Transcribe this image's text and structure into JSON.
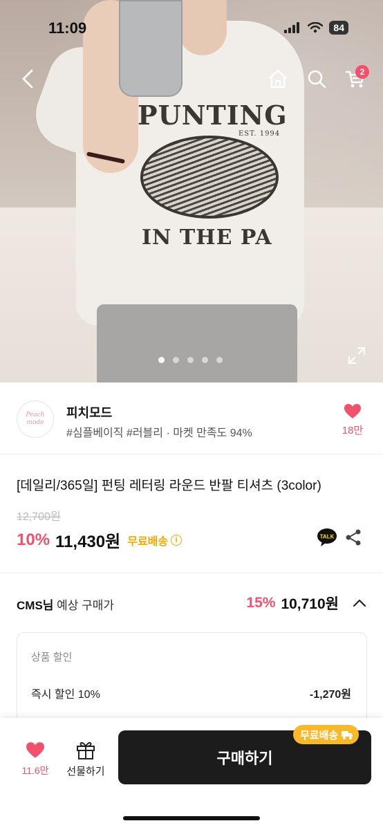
{
  "status_bar": {
    "time": "11:09",
    "battery": "84"
  },
  "nav": {
    "cart_count": "2"
  },
  "hero_print": {
    "line1": "PUNTING",
    "line2": "EST. 1994",
    "line3": "IN THE PA"
  },
  "gallery": {
    "dot_count": 5,
    "active_index": 0
  },
  "store": {
    "logo_text": "Peach mode",
    "name": "피치모드",
    "tags": "#심플베이직 #러블리 · 마켓 만족도 94%",
    "like_count": "18만"
  },
  "product": {
    "title": "[데일리/365일] 펀팅 레터링 라운드 반팔 티셔츠 (3color)",
    "original_price": "12,700원",
    "discount": "10%",
    "price": "11,430원",
    "free_shipping": "무료배송",
    "talk_label": "TALK"
  },
  "expected": {
    "user": "CMS님",
    "label": " 예상 구매가",
    "discount": "15%",
    "price": "10,710원"
  },
  "breakdown": {
    "title": "상품 할인",
    "row_label": "즉시 할인 10%",
    "row_value": "-1,270원"
  },
  "bottom_bar": {
    "wish_count": "11.6만",
    "gift_label": "선물하기",
    "buy_label": "구매하기",
    "ship_chip": "무료배송"
  },
  "colors": {
    "accent": "#f1516d",
    "shipping": "#f5a600",
    "buy_button": "#1c1c1c"
  }
}
